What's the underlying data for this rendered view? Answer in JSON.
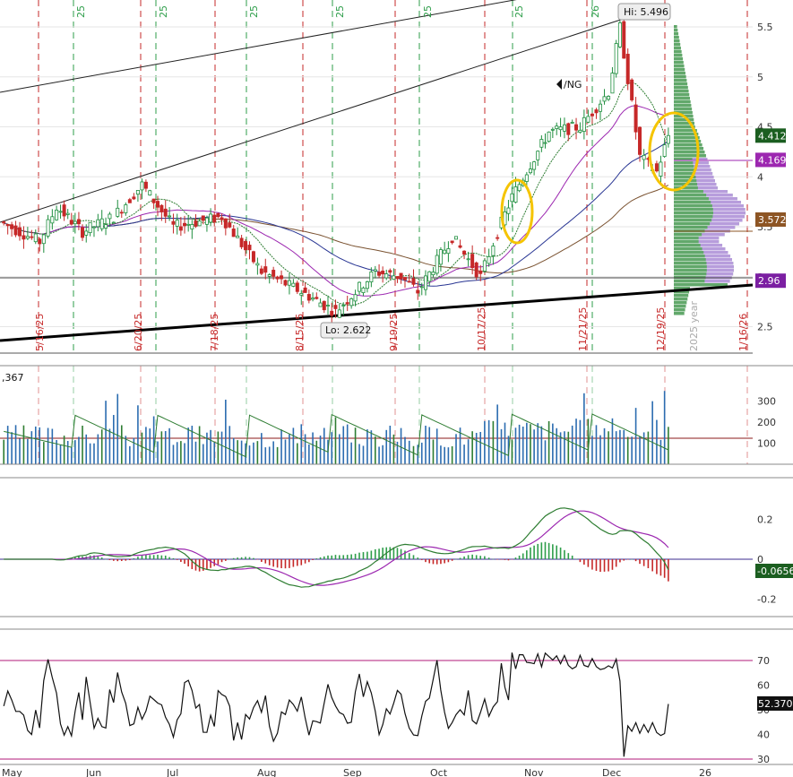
{
  "symbol_label": "/NG",
  "price_scale": [
    "5.5",
    "5",
    "4.5",
    "4",
    "3.5",
    "3",
    "2.5"
  ],
  "price_badges": [
    {
      "text": "4.412",
      "value": 4.412,
      "bg": "#1b5e20"
    },
    {
      "text": "4.169",
      "value": 4.169,
      "bg": "#9c27b0"
    },
    {
      "text": "3.572",
      "value": 3.572,
      "bg": "#8d5524"
    },
    {
      "text": "2.96",
      "value": 2.96,
      "bg": "#7b1fa2"
    }
  ],
  "callouts": {
    "high": "Hi: 5.496",
    "low": "Lo: 2.622"
  },
  "expiry_dates": [
    "5/16/25",
    "6/20/25",
    "7/18/25",
    "8/15/25",
    "9/19/25",
    "10/17/25",
    "11/21/25",
    "12/19/25",
    "1/16/26"
  ],
  "year_tag": "2025 year",
  "top_month_tags": [
    "25",
    "25",
    "25",
    "25",
    "25",
    "25",
    "26"
  ],
  "volume_panel": {
    "left_label": ",367",
    "scale": [
      "300",
      "200",
      "100"
    ]
  },
  "macd_panel": {
    "scale": [
      "0.2",
      "0",
      "-0.2"
    ],
    "badge": "-0.0656"
  },
  "rsi_panel": {
    "scale": [
      "70",
      "60",
      "50",
      "40",
      "30"
    ],
    "badge": "52.3705"
  },
  "x_axis": [
    "May",
    "Jun",
    "Jul",
    "Aug",
    "Sep",
    "Oct",
    "Nov",
    "Dec",
    "26"
  ],
  "colors": {
    "up": "#1e8e3e",
    "down": "#c62828",
    "ma_green": "#2e7d32",
    "ma_blue": "#283593",
    "ma_purple": "#9c27b0",
    "ma_brown": "#7a5230",
    "highlight": "#f5c400"
  },
  "chart_data": {
    "type": "candlestick",
    "symbol": "/NG",
    "period": "May 2025 - Jan 2026 (daily)",
    "high": 5.496,
    "low": 2.622,
    "last_price": 4.412,
    "y_range": [
      2.2,
      5.8
    ],
    "reference_levels": [
      4.169,
      3.572,
      2.96
    ],
    "close_path": [
      {
        "date": "2025-05-01",
        "close": 3.55
      },
      {
        "date": "2025-05-15",
        "close": 3.35
      },
      {
        "date": "2025-05-21",
        "close": 3.7
      },
      {
        "date": "2025-05-30",
        "close": 3.45
      },
      {
        "date": "2025-06-10",
        "close": 3.6
      },
      {
        "date": "2025-06-20",
        "close": 3.92
      },
      {
        "date": "2025-07-01",
        "close": 3.5
      },
      {
        "date": "2025-07-18",
        "close": 3.6
      },
      {
        "date": "2025-08-01",
        "close": 3.05
      },
      {
        "date": "2025-08-15",
        "close": 2.85
      },
      {
        "date": "2025-08-27",
        "close": 2.65
      },
      {
        "date": "2025-09-10",
        "close": 3.05
      },
      {
        "date": "2025-09-19",
        "close": 3.0
      },
      {
        "date": "2025-09-25",
        "close": 2.85
      },
      {
        "date": "2025-10-07",
        "close": 3.4
      },
      {
        "date": "2025-10-17",
        "close": 3.0
      },
      {
        "date": "2025-10-23",
        "close": 3.45
      },
      {
        "date": "2025-10-28",
        "close": 3.8
      },
      {
        "date": "2025-11-10",
        "close": 4.45
      },
      {
        "date": "2025-11-21",
        "close": 4.5
      },
      {
        "date": "2025-12-01",
        "close": 4.85
      },
      {
        "date": "2025-12-05",
        "close": 5.496
      },
      {
        "date": "2025-12-12",
        "close": 4.2
      },
      {
        "date": "2025-12-18",
        "close": 4.05
      },
      {
        "date": "2025-12-22",
        "close": 4.412
      }
    ],
    "volume_scale": [
      100,
      200,
      300
    ],
    "macd": {
      "last": -0.0656,
      "range": [
        -0.3,
        0.35
      ]
    },
    "rsi": {
      "last": 52.3705,
      "overbought": 70,
      "oversold": 30
    }
  }
}
